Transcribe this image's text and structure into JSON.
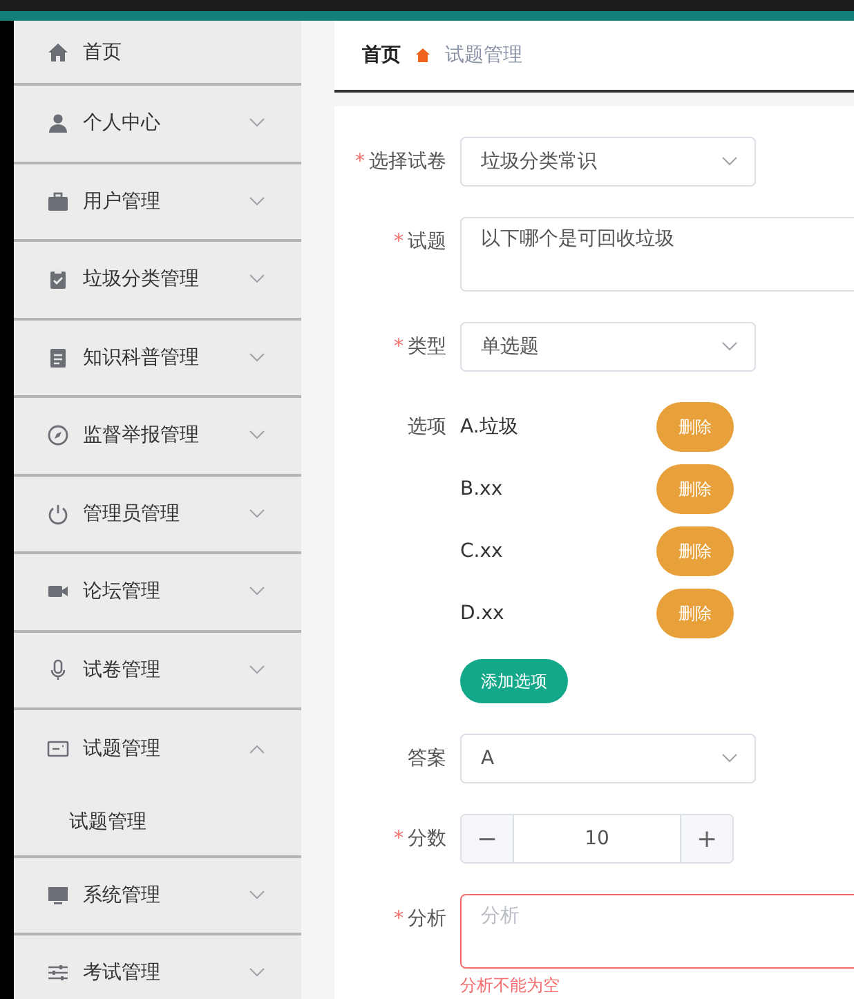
{
  "sidebar": {
    "items": [
      {
        "kind": "link",
        "label": "首页"
      },
      {
        "kind": "menu",
        "label": "个人中心",
        "expanded": false
      },
      {
        "kind": "menu",
        "label": "用户管理",
        "expanded": false
      },
      {
        "kind": "menu",
        "label": "垃圾分类管理",
        "expanded": false
      },
      {
        "kind": "menu",
        "label": "知识科普管理",
        "expanded": false
      },
      {
        "kind": "menu",
        "label": "监督举报管理",
        "expanded": false
      },
      {
        "kind": "menu",
        "label": "管理员管理",
        "expanded": false
      },
      {
        "kind": "menu",
        "label": "论坛管理",
        "expanded": false
      },
      {
        "kind": "menu",
        "label": "试卷管理",
        "expanded": false
      },
      {
        "kind": "menu",
        "label": "试题管理",
        "expanded": true,
        "children": [
          {
            "label": "试题管理"
          }
        ]
      },
      {
        "kind": "menu",
        "label": "系统管理",
        "expanded": false
      },
      {
        "kind": "menu",
        "label": "考试管理",
        "expanded": false
      }
    ]
  },
  "breadcrumb": [
    "首页",
    "试题管理"
  ],
  "form": {
    "fields": [
      {
        "kind": "select",
        "label": "选择试卷",
        "marker": "*",
        "value": "垃圾分类常识"
      },
      {
        "kind": "textarea",
        "label": "试题",
        "marker": "*",
        "value": "以下哪个是可回收垃圾"
      },
      {
        "kind": "select",
        "label": "类型",
        "marker": "*",
        "value": "单选题"
      },
      {
        "kind": "options",
        "label": "选项",
        "options": [
          {
            "text": "A.垃圾",
            "button": "删除"
          },
          {
            "text": "B.xx",
            "button": "删除"
          },
          {
            "text": "C.xx",
            "button": "删除"
          },
          {
            "text": "D.xx",
            "button": "删除"
          }
        ],
        "add_button": "添加选项"
      },
      {
        "kind": "select",
        "label": "答案",
        "value": "A"
      },
      {
        "kind": "number",
        "label": "分数",
        "marker": "*",
        "value": "10",
        "minus": "−",
        "plus": "+"
      },
      {
        "kind": "textarea",
        "label": "分析",
        "marker": "*",
        "placeholder": "分析",
        "error": "分析不能为空"
      }
    ]
  }
}
